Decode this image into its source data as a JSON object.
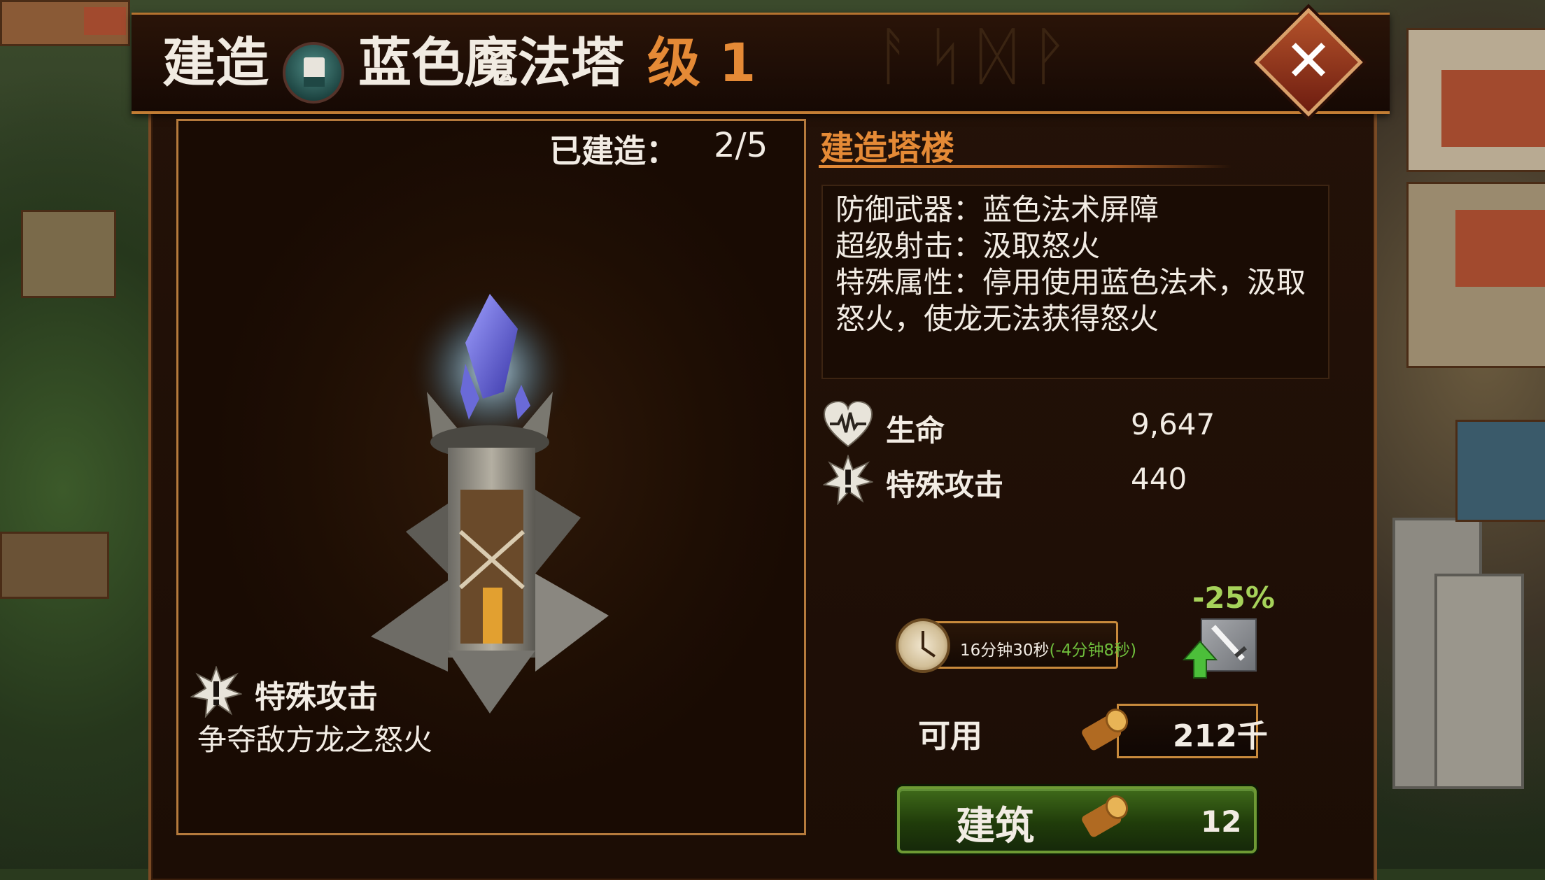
{
  "header": {
    "action": "建造",
    "tower_name": "蓝色魔法塔",
    "level": "级 1",
    "close_label": "✕"
  },
  "preview": {
    "built_label": "已建造：",
    "built_value": "2/5",
    "special_title": "特殊攻击",
    "special_desc": "争夺敌方龙之怒火"
  },
  "info": {
    "section_title": "建造塔楼",
    "desc_lines": [
      "防御武器：蓝色法术屏障",
      "超级射击：汲取怒火",
      "特殊属性：停用使用蓝色法术，汲取",
      "怒火，使龙无法获得怒火"
    ],
    "stats": [
      {
        "icon": "heart-icon",
        "label": "生命",
        "value": "9,647"
      },
      {
        "icon": "special-attack-icon",
        "label": "特殊攻击",
        "value": "440"
      }
    ]
  },
  "build": {
    "discount": "-25%",
    "time": "16分钟30秒",
    "time_reduction": "(-4分钟8秒)",
    "available_label": "可用",
    "available_value": "212千",
    "button_label": "建筑",
    "cost": "12"
  },
  "colors": {
    "accent": "#e58a36",
    "border": "#c88a3c",
    "button_green": "#3f6a1a",
    "discount_green": "#a6d25a"
  }
}
